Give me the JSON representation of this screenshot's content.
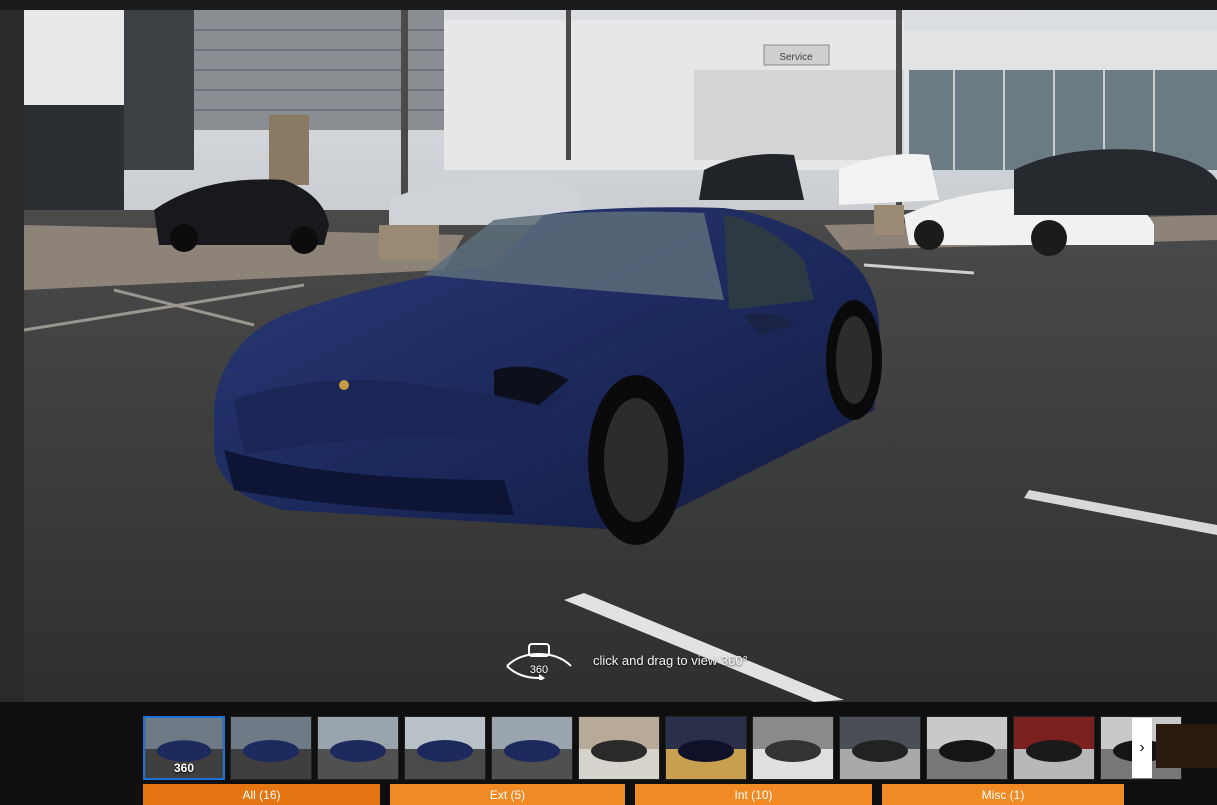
{
  "viewer": {
    "hint_text": "click and drag to view 360°",
    "hint_icon_label": "360"
  },
  "thumbnails": [
    {
      "label": "360",
      "kind": "exterior-front",
      "active": true
    },
    {
      "label": "",
      "kind": "exterior-front"
    },
    {
      "label": "",
      "kind": "exterior-side"
    },
    {
      "label": "",
      "kind": "exterior-rear"
    },
    {
      "label": "",
      "kind": "exterior-side"
    },
    {
      "label": "",
      "kind": "trunk"
    },
    {
      "label": "",
      "kind": "interior-screen"
    },
    {
      "label": "",
      "kind": "cargo"
    },
    {
      "label": "",
      "kind": "interior-seat"
    },
    {
      "label": "",
      "kind": "steering-wheel"
    },
    {
      "label": "",
      "kind": "interior-seat-red"
    },
    {
      "label": "",
      "kind": "steering-wheel"
    }
  ],
  "next_label": "›",
  "tabs": [
    {
      "label": "All (16)",
      "active": true
    },
    {
      "label": "Ext (5)"
    },
    {
      "label": "Int (10)"
    },
    {
      "label": "Misc (1)"
    }
  ],
  "colors": {
    "accent": "#e57512",
    "tab": "#f08a24",
    "active_thumb_border": "#1e6fd8",
    "car_body": "#1d2a5e"
  },
  "scene": {
    "service_sign": "Service"
  }
}
